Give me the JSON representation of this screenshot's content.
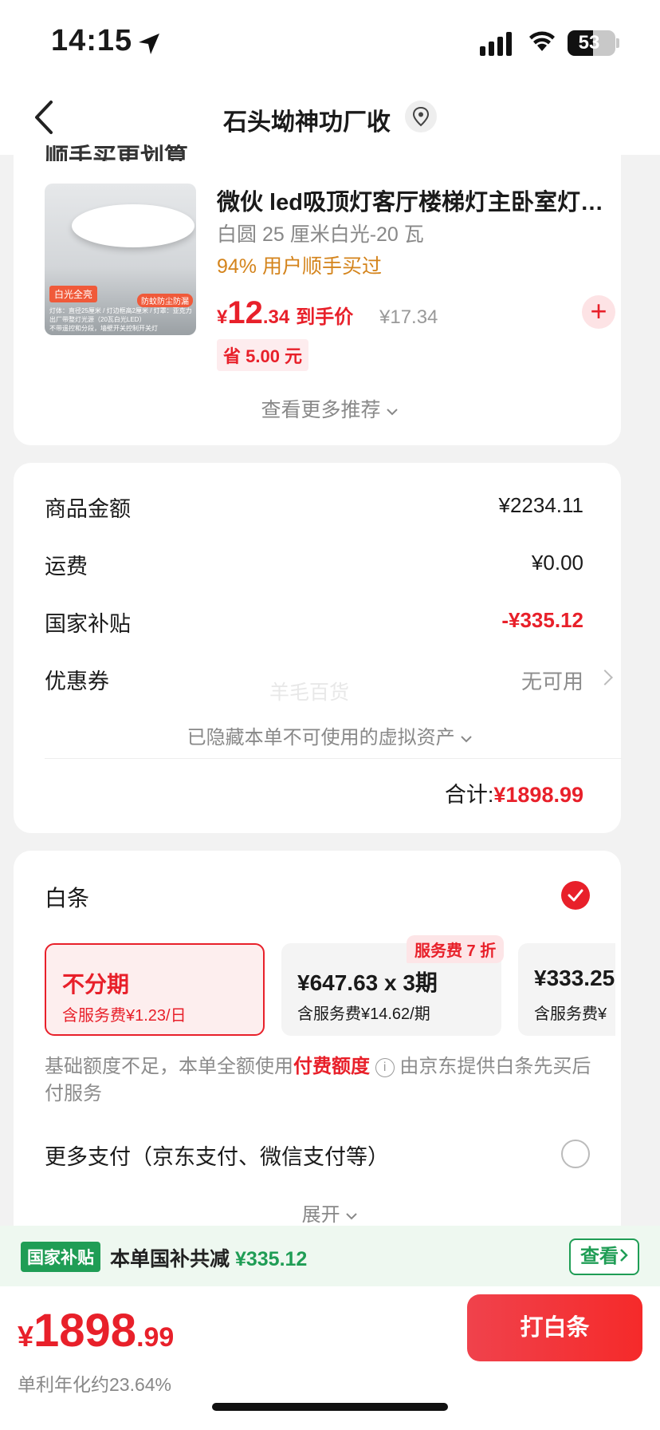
{
  "status_bar": {
    "time": "14:15",
    "battery": "53"
  },
  "nav": {
    "title": "石头坳神功厂收"
  },
  "recommend": {
    "header": "顺手买更划算",
    "image_tag": "白光全亮",
    "image_badge": "防蚊防尘防漏",
    "image_lines": [
      "灯体：直径25厘米 / 灯边框高2厘米 / 灯罩：亚克力",
      "出厂带整灯光源（20瓦白光LED）",
      "不带遥控和分段，墙壁开关控制开关灯"
    ],
    "title": "微伙 led吸顶灯客厅楼梯灯主卧室灯…",
    "spec": "白圆 25 厘米白光-20 瓦",
    "bought": "94% 用户顺手买过",
    "price_symbol": "¥",
    "price_int": "12",
    "price_dec": ".34",
    "price_label": "到手价",
    "orig_price": "¥17.34",
    "save": "省 5.00 元",
    "more": "查看更多推荐"
  },
  "summary": {
    "rows": [
      {
        "label": "商品金额",
        "value": "¥2234.11"
      },
      {
        "label": "运费",
        "value": "¥0.00"
      },
      {
        "label": "国家补贴",
        "value": "-¥335.12"
      },
      {
        "label": "优惠券",
        "value": "无可用"
      }
    ],
    "watermark": "羊毛百货",
    "hidden_assets": "已隐藏本单不可使用的虚拟资产",
    "total_label": "合计:",
    "total_value": "¥1898.99"
  },
  "payment": {
    "baitiao": "白条",
    "plans": [
      {
        "title": "不分期",
        "sub": "含服务费¥1.23/日",
        "selected": true
      },
      {
        "title": "¥647.63 x 3期",
        "sub": "含服务费¥14.62/期",
        "selected": false
      },
      {
        "title": "¥333.25",
        "sub": "含服务费¥",
        "selected": false
      }
    ],
    "plan_badge": "服务费 7 折",
    "note_pre": "基础额度不足，本单全额使用",
    "note_hl": "付费额度",
    "note_post": "由京东提供白条先买后付服务",
    "more_pay": "更多支付（京东支付、微信支付等）",
    "expand": "展开"
  },
  "subsidy": {
    "tag": "国家补贴",
    "text": "本单国补共减",
    "amount": "¥335.12",
    "button": "查看"
  },
  "bottom": {
    "symbol": "¥",
    "price_int": "1898",
    "price_dec": ".99",
    "apr": "单利年化约23.64%",
    "pay": "打白条"
  },
  "colors": {
    "accent_red": "#e8202a",
    "subsidy_green": "#1f9d55",
    "bought_orange": "#d4841c"
  }
}
